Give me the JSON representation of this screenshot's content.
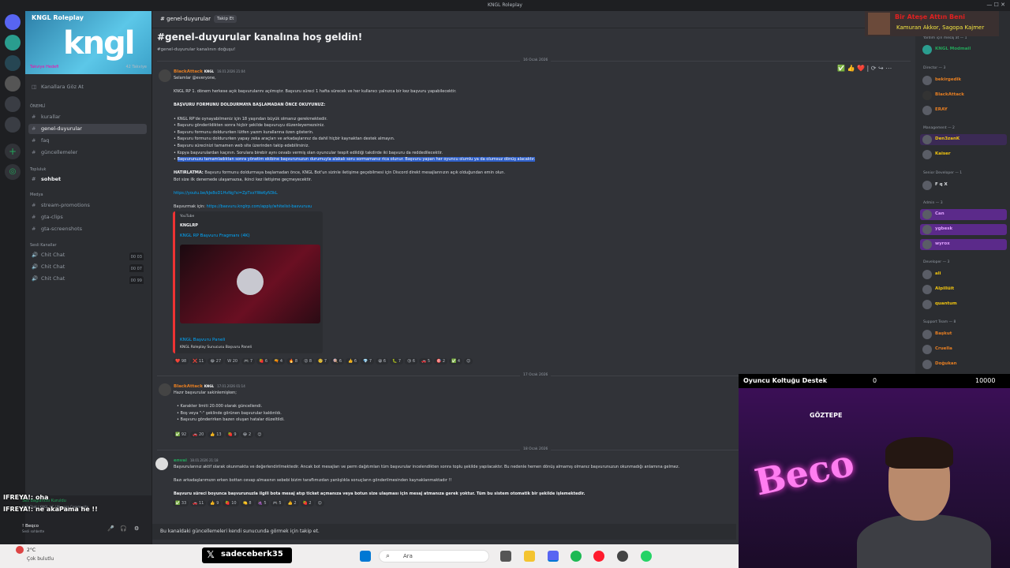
{
  "window": {
    "title": "KNGL Roleplay"
  },
  "server": {
    "name": "KNGL Roleplay",
    "banner_logo": "kngl",
    "boost_label": "Takviye Hedefi",
    "boost_count": "42 Takviye",
    "browse_channels": "Kanallara Göz At",
    "categories": [
      {
        "label": "ÖNEMLİ"
      },
      {
        "label": "Topluluk"
      },
      {
        "label": "Medya"
      },
      {
        "label": "Sesli Kanallar"
      }
    ],
    "channels": {
      "important": [
        "kurallar",
        "genel-duyurular",
        "faq",
        "güncellemeler"
      ],
      "community": [
        "sohbet"
      ],
      "media": [
        "stream-promotions",
        "gta-clips",
        "gta-screenshots"
      ],
      "voice": [
        {
          "name": "Chit Chat",
          "count": "00 03"
        },
        {
          "name": "Chit Chat",
          "count": "00 07"
        },
        {
          "name": "Chit Chat",
          "count": "00 99"
        }
      ]
    },
    "voice_status": "Ses Bağlantısı Kuruldu",
    "voice_sub": "Chit Chat / KNGL VC / Nirvana Community",
    "user_name": "! Beqco",
    "user_status": "Sesli sohbette"
  },
  "channel_header": {
    "name": "genel-duyurular",
    "follow_label": "Takip Et"
  },
  "welcome": {
    "title": "#genel-duyurular kanalına hoş geldin!",
    "subtitle": "#genel-duyurular kanalının doğuşu!"
  },
  "dates": [
    "16 Ocak 2026",
    "17 Ocak 2026",
    "18 Ocak 2026"
  ],
  "messages": [
    {
      "author": "BlackAttack",
      "tag": "KNGL",
      "time": "16.01.2026 21:04",
      "lines": [
        "Selamlar @everyone,",
        "",
        "KNGL RP 1. dönem herkese açık başvurularını açılmıştır. Başvuru süreci 1 hafta sürecek ve her kullanıcı yalnızca bir kez başvuru yapabilecektir.",
        "",
        "BAŞVURU FORMUNU DOLDURMAYA BAŞLAMADAN ÖNCE OKUYUNUZ:",
        "",
        "• KNGL RP'de oynayabilmeniz için 18 yaşından büyük olmanız gerekmektedir.",
        "• Başvuru gönderildikten sonra hiçbir şekilde başvuruyu düzenleyemezsiniz.",
        "• Başvuru formunu doldururken lütfen yazım kurallarına özen gösterin.",
        "• Başvuru formunu doldururken yapay zeka araçları ve arkadaşlarınız da dahil hiçbir kaynaktan destek almayın.",
        "• Başvuru sürecinizi tamamen web site üzerinden takip edebilirsiniz.",
        "• Kopya başvurulardan kaçının. Sorulara birebir aynı cevabı vermiş olan oyuncular tespit edildiği takdirde iki başvuru da reddedilecektir."
      ],
      "highlight_line": "Başvurunuzu tamamladıktan sonra yönetim ekibine başvurunuzun durumuyla alakalı soru sormamanız rica olunur. Başvuru yapan her oyuncu olumlu ya da olumsuz dönüş alacaktır.",
      "warning_label": "HATIRLATMA:",
      "warning_text": "Başvuru formunu doldurmaya başlamadan önce, KNGL Bot'un sizinle iletişime geçebilmesi için Discord direkt mesajlarınızın açık olduğundan emin olun.",
      "warning_text2": "Bot size ilk denemede ulaşamazsa, ikinci kez iletişime geçmeyecektir.",
      "yt_link": "https://youtu.be/kJe8oD1HvNg?si=ZpTxxYWeKyN3kL",
      "apply_label": "Başvurmak için:",
      "apply_link": "https://basvuru.knglrp.com/apply/whitelist-basvurusu",
      "embed": {
        "provider": "YouTube",
        "author": "KNGLRP",
        "title": "KNGL RP Başvuru Fragmanı (4K)",
        "footer_title": "KNGL Başvuru Paneli",
        "footer_sub": "KNGL Roleplay Sunucusu Başvuru Paneli"
      },
      "reactions": [
        "❤️ 98",
        "❌ 11",
        "😂 27",
        "W 20",
        "🎮 7",
        "🍓 6",
        "🔫 4",
        "🔥 8",
        "😮 8",
        "🧐 7",
        "🍭 6",
        "👍 6",
        "💎 7",
        "😀 6",
        "🐛 7",
        "😘 6",
        "🚗 5",
        "🎯 2",
        "✅ 4",
        "😊"
      ]
    },
    {
      "author": "BlackAttack",
      "tag": "KNGL",
      "time": "17.01.2026 01:14",
      "lines": [
        "Hazır başvurular sakinlemişken;",
        "",
        "• Karakter limiti 20.000 olarak güncellendi.",
        "• Boş veya \"-\" şeklinde görünen başvurular kaldırıldı.",
        "• Başvuru gönderirken bazen oluşan hatalar düzeltildi."
      ],
      "reactions": [
        "✅ 92",
        "🚗 20",
        "👍 13",
        "🍓 9",
        "😂 2",
        "😊"
      ]
    },
    {
      "author": "envai",
      "tag": "",
      "time": "18.01.2026 21:18",
      "lines": [
        "Başvurularınız aktif olarak okunmakta ve değerlendirilmektedir. Ancak bot mesajları ve perm dağıtımları tüm başvurular incelendikten sonra toplu şekilde yapılacaktır. Bu nedenle hemen dönüş almamış olmanız başvurunuzun okunmadığı anlamına gelmez.",
        "",
        "Bazı arkadaşlarımızın erken bottan cevap almasının sebebi bizim taraflımızdan yanlışlıkla sonuçların gönderilmesinden kaynaklanmaktadır !!",
        "",
        "Başvuru süreci boyunca başvurunuzla ilgili bota mesaj atıp ticket açmanıza veya botun size ulaşması için mesaj atmanıza gerek yoktur. Tüm bu sistem otomatik bir şekilde işlemektedir."
      ],
      "reactions": [
        "✅ 33",
        "🚗 11",
        "👍 9",
        "🍓 10",
        "🍋 8",
        "🍇 5",
        "🎮 5",
        "👍 2",
        "🍓 2",
        "😊"
      ]
    }
  ],
  "follow_banner": "Bu kanaldaki güncellemeleri kendi sunucunda görmek için takip et.",
  "members": {
    "groups": [
      {
        "label": "Yardım için mesaj at — 1",
        "members": [
          {
            "name": "KNGL Modmail",
            "color": "#23a55a"
          }
        ]
      },
      {
        "label": "Director — 3",
        "members": [
          {
            "name": "bekirgedik",
            "color": "#e67e22"
          },
          {
            "name": "BlackAttack",
            "color": "#e67e22"
          },
          {
            "name": "ERAY",
            "color": "#e67e22"
          }
        ]
      },
      {
        "label": "Management — 2",
        "members": [
          {
            "name": "Den3zanK",
            "color": "#f1c40f"
          },
          {
            "name": "Kaiser",
            "color": "#f1c40f"
          }
        ]
      },
      {
        "label": "Senior Developer — 1",
        "members": [
          {
            "name": "F q X",
            "color": "#dbdee1"
          }
        ]
      },
      {
        "label": "Admin — 3",
        "members": [
          {
            "name": "Can",
            "color": "#e0a0ff"
          },
          {
            "name": "ygbesk",
            "color": "#e0a0ff"
          },
          {
            "name": "wyrox",
            "color": "#e0a0ff"
          }
        ]
      },
      {
        "label": "Developer — 3",
        "members": [
          {
            "name": "ali",
            "color": "#f1c40f"
          },
          {
            "name": "Alpillüit",
            "color": "#f1c40f"
          },
          {
            "name": "quantum",
            "color": "#f1c40f"
          }
        ]
      },
      {
        "label": "Support Team — 8",
        "members": [
          {
            "name": "Başkut",
            "color": "#e67e22"
          },
          {
            "name": "Cruella",
            "color": "#e67e22"
          },
          {
            "name": "Doğukan",
            "color": "#e67e22"
          }
        ]
      }
    ]
  },
  "overlay": {
    "alert_title": "Bir Ateşe Attın Beni",
    "alert_sub": "Kamuran Akkor, Sagopa Kajmer"
  },
  "stream": {
    "goal_label": "Oyuncu Koltuğu Destek",
    "goal_current": "0",
    "goal_target": "10000",
    "neon_text": "Beco",
    "neon_sub": "GÖZTEPE"
  },
  "taskbar": {
    "weather_temp": "2°C",
    "weather_text": "Çok bulutlu",
    "search_placeholder": "Ara"
  },
  "handle": "sadeceberk35",
  "chat_overlay": [
    {
      "user": "IFREYA!:",
      "text": "oha"
    },
    {
      "user": "IFREYA!:",
      "text": "ne akaPama he !!"
    }
  ]
}
